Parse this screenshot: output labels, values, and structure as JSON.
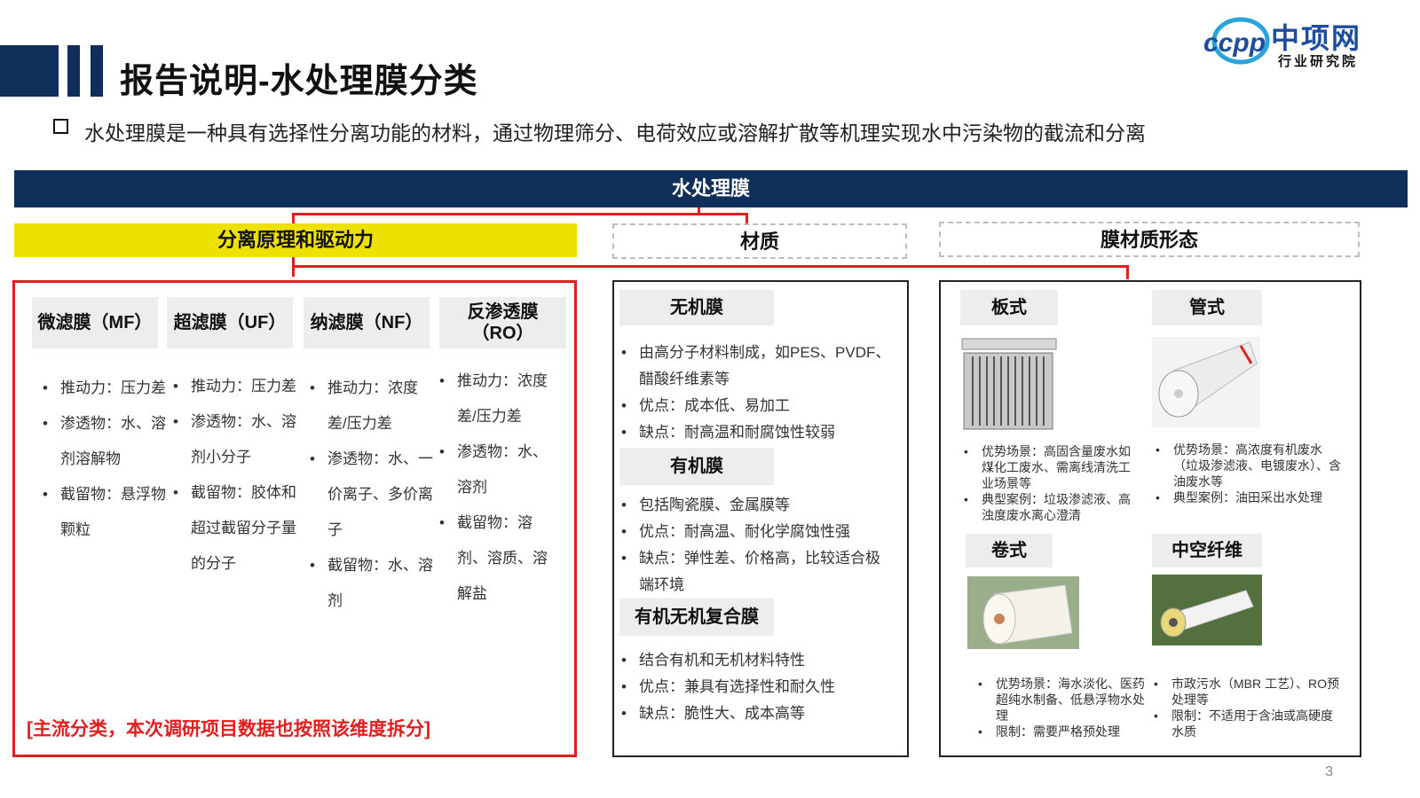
{
  "logo": {
    "brand": "中项网",
    "sub": "行业研究院",
    "mark": "ccpp"
  },
  "title": "报告说明-水处理膜分类",
  "intro": "水处理膜是一种具有选择性分离功能的材料，通过物理筛分、电荷效应或溶解扩散等机理实现水中污染物的截流和分离",
  "root": "水处理膜",
  "categories": {
    "principle": "分离原理和驱动力",
    "material": "材质",
    "form": "膜材质形态"
  },
  "principle_columns": [
    {
      "name": "微滤膜（MF）",
      "items": [
        "推动力：压力差",
        "渗透物：水、溶剂溶解物",
        "截留物：悬浮物颗粒"
      ]
    },
    {
      "name": "超滤膜（UF）",
      "items": [
        "推动力：压力差",
        "渗透物：水、溶剂小分子",
        "截留物：胶体和超过截留分子量的分子"
      ]
    },
    {
      "name": "纳滤膜（NF）",
      "items": [
        "推动力：浓度差/压力差",
        "渗透物：水、一价离子、多价离子",
        "截留物：水、溶剂"
      ]
    },
    {
      "name": "反渗透膜（RO）",
      "items": [
        "推动力：浓度差/压力差",
        "渗透物：水、溶剂",
        "截留物：溶剂、溶质、溶解盐"
      ]
    }
  ],
  "note": "[主流分类，本次调研项目数据也按照该维度拆分]",
  "materials": [
    {
      "name": "无机膜",
      "items": [
        "由高分子材料制成，如PES、PVDF、醋酸纤维素等",
        "优点：成本低、易加工",
        "缺点：耐高温和耐腐蚀性较弱"
      ]
    },
    {
      "name": "有机膜",
      "items": [
        "包括陶瓷膜、金属膜等",
        "优点：耐高温、耐化学腐蚀性强",
        "缺点：弹性差、价格高，比较适合极端环境"
      ]
    },
    {
      "name": "有机无机复合膜",
      "items": [
        "结合有机和无机材料特性",
        "优点：兼具有选择性和耐久性",
        "缺点：脆性大、成本高等"
      ]
    }
  ],
  "forms": [
    {
      "name": "板式",
      "items": [
        "优势场景：高固含量废水如煤化工废水、需离线清洗工业场景等",
        "典型案例：垃圾渗滤液、高浊度废水离心澄清"
      ]
    },
    {
      "name": "管式",
      "items": [
        "优势场景：高浓度有机废水（垃圾渗滤液、电镀废水）、含油废水等",
        "典型案例：油田采出水处理"
      ]
    },
    {
      "name": "卷式",
      "items": [
        "优势场景：海水淡化、医药超纯水制备、低悬浮物水处理",
        "限制：需要严格预处理"
      ]
    },
    {
      "name": "中空纤维",
      "items": [
        "市政污水（MBR 工艺）、RO预处理等",
        "限制：不适用于含油或高硬度水质"
      ]
    }
  ],
  "page_number": "3",
  "colors": {
    "navy": "#0f2f5a",
    "yellow": "#ece100",
    "red": "#e41e1e",
    "gray_head": "#ededed"
  }
}
